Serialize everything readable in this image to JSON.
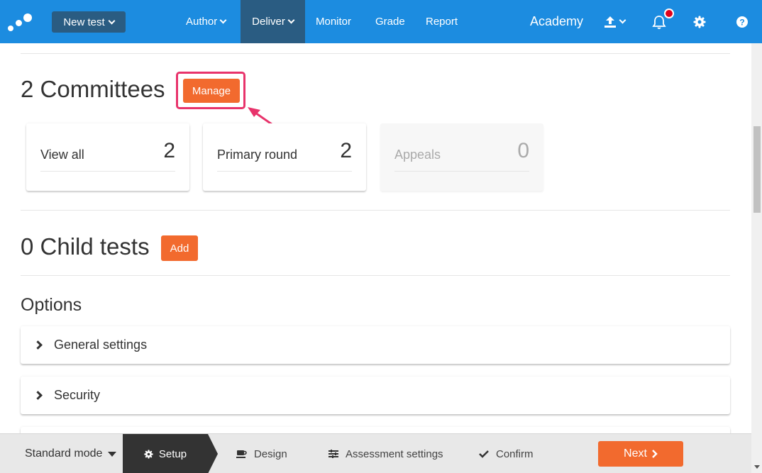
{
  "nav": {
    "new_test": "New test",
    "items": [
      {
        "label": "Author"
      },
      {
        "label": "Deliver"
      },
      {
        "label": "Monitor"
      },
      {
        "label": "Grade"
      },
      {
        "label": "Report"
      }
    ],
    "org": "Academy"
  },
  "committees": {
    "title": "2 Committees",
    "manage_label": "Manage",
    "cards": [
      {
        "label": "View all",
        "count": "2"
      },
      {
        "label": "Primary round",
        "count": "2"
      },
      {
        "label": "Appeals",
        "count": "0"
      }
    ]
  },
  "child_tests": {
    "title": "0 Child tests",
    "add_label": "Add"
  },
  "options": {
    "title": "Options",
    "sections": [
      {
        "label": "General settings"
      },
      {
        "label": "Security"
      }
    ]
  },
  "footer": {
    "mode": "Standard mode",
    "steps": [
      {
        "label": "Setup"
      },
      {
        "label": "Design"
      },
      {
        "label": "Assessment settings"
      },
      {
        "label": "Confirm"
      }
    ],
    "next_label": "Next"
  },
  "colors": {
    "nav_bg": "#1c8ce0",
    "nav_active": "#2a5c82",
    "accent": "#f26a2e",
    "highlight": "#e8336b",
    "notification": "#e0001b"
  }
}
